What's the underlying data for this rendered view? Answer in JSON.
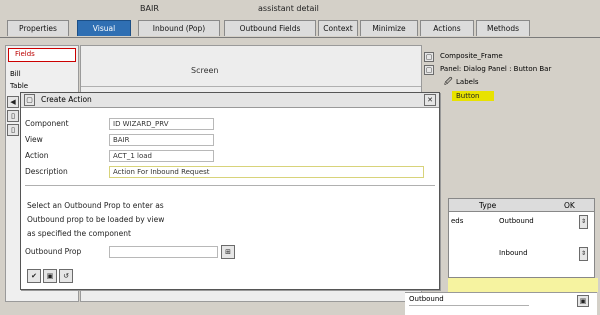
{
  "header": {
    "left_text": "BAIR",
    "right_text": "assistant detail"
  },
  "tabs": [
    {
      "label": "Properties"
    },
    {
      "label": "Visual"
    },
    {
      "label": "Inbound (Pop)"
    },
    {
      "label": "Outbound Fields"
    },
    {
      "label": "Context"
    },
    {
      "label": "Minimize"
    },
    {
      "label": "Actions"
    },
    {
      "label": "Methods"
    }
  ],
  "left": {
    "items": [
      "Fields",
      "Bill",
      "Table"
    ]
  },
  "center": {
    "header_label": "Screen"
  },
  "tree": {
    "items": [
      {
        "label": "Composite_Frame"
      },
      {
        "label": "Panel: Dialog Panel : Button Bar"
      },
      {
        "label": "Labels"
      },
      {
        "label": "Button"
      }
    ]
  },
  "dialog": {
    "title": "Create Action",
    "rows": [
      {
        "label": "Component",
        "value": "ID WIZARD_PRV"
      },
      {
        "label": "View",
        "value": "BAIR"
      },
      {
        "label": "Action",
        "value": "ACT_1 load"
      },
      {
        "label": "Description",
        "value": "Action For Inbound Request"
      }
    ],
    "help_lines": [
      "Select an Outbound Prop to enter as",
      "Outbound prop to be loaded by view",
      "as specified the component"
    ],
    "outbound_label": "Outbound Prop",
    "outbound_value": ""
  },
  "grid": {
    "headers": [
      "Type",
      "OK"
    ],
    "rows": [
      {
        "prefix": "eds",
        "value": "Outbound"
      },
      {
        "prefix": "",
        "value": ""
      },
      {
        "prefix": "",
        "value": "Inbound"
      }
    ]
  },
  "bottom": {
    "label": "Outbound"
  },
  "colors": {
    "accent": "#2f6fb3",
    "highlight": "#f6f3a0",
    "selection": "#e8e200"
  }
}
